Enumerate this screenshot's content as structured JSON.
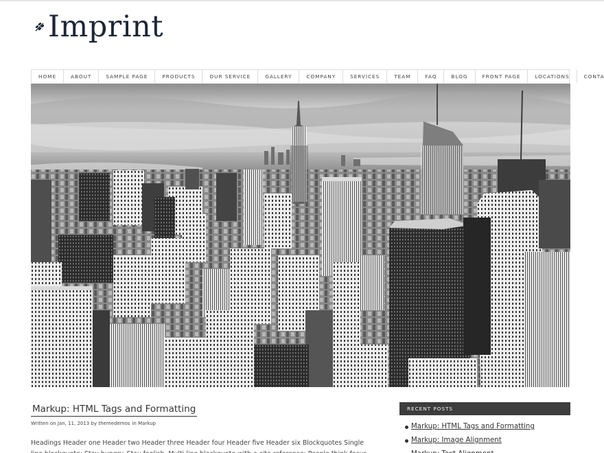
{
  "site": {
    "title": "Imprint",
    "logo_icon": "leaf-sprig-icon",
    "brand_color": "#1c2636"
  },
  "nav": {
    "items": [
      "HOME",
      "ABOUT",
      "SAMPLE PAGE",
      "PRODUCTS",
      "OUR SERVICE",
      "GALLERY",
      "COMPANY",
      "SERVICES",
      "TEAM",
      "FAQ",
      "BLOG",
      "FRONT PAGE",
      "LOCATIONS",
      "CONTACT"
    ]
  },
  "hero": {
    "description_icon": "city-skyline-photo"
  },
  "post": {
    "title": "Markup: HTML Tags and Formatting",
    "meta_prefix": "Written on",
    "date": "Jan, 11, 2013",
    "by": "by",
    "author": "themedemos",
    "in": "in",
    "category": "Markup",
    "excerpt": "Headings Header one Header two Header three Header four Header five Header six Blockquotes Single line blockquote: Stay hungry. Stay foolish. Multi line blockquote with a cite reference: People think focus"
  },
  "sidebar": {
    "recent_heading": "RECENT POSTS",
    "recent_posts": [
      "Markup: HTML Tags and Formatting",
      "Markup: Image Alignment",
      "Markup: Text Alignment"
    ]
  },
  "colors": {
    "sidebar_heading_bg": "#3d3d3d",
    "nav_border": "#dcdcdc"
  }
}
